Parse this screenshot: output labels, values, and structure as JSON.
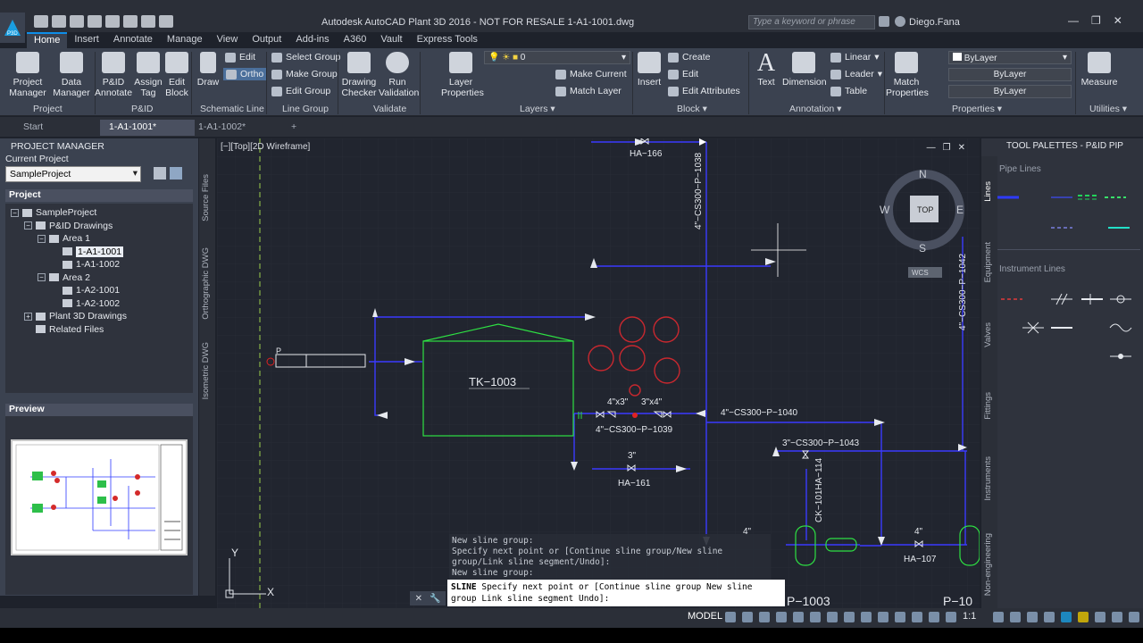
{
  "window": {
    "title": "Autodesk AutoCAD Plant 3D 2016 - NOT FOR RESALE   1-A1-1001.dwg",
    "search_placeholder": "Type a keyword or phrase",
    "user": "Diego.Fana",
    "app_badge": "P3D"
  },
  "tabs": [
    "Home",
    "Insert",
    "Annotate",
    "Manage",
    "View",
    "Output",
    "Add-ins",
    "A360",
    "Vault",
    "Express Tools"
  ],
  "ribbon": {
    "project_manager": "Project\nManager",
    "data_manager": "Data\nManager",
    "pid_annotate": "P&ID\nAnnotate",
    "assign_tag": "Assign\nTag",
    "edit_block": "Edit\nBlock",
    "draw": "Draw",
    "edit": "Edit",
    "ortho": "Ortho",
    "select_group": "Select Group",
    "make_group": "Make Group",
    "edit_group": "Edit Group",
    "drawing_checker": "Drawing\nChecker",
    "run_validation": "Run\nValidation",
    "layer_properties": "Layer\nProperties",
    "layer_value": "0",
    "make_current": "Make Current",
    "match_layer": "Match Layer",
    "insert": "Insert",
    "create": "Create",
    "block_edit": "Edit",
    "edit_attributes": "Edit Attributes",
    "text": "Text",
    "dimension": "Dimension",
    "linear": "Linear",
    "leader": "Leader",
    "table": "Table",
    "match_properties": "Match\nProperties",
    "bylayer1": "ByLayer",
    "bylayer2": "ByLayer",
    "bylayer3": "ByLayer",
    "measure": "Measure",
    "panels": {
      "project": "Project",
      "pid": "P&ID",
      "schematic_line": "Schematic Line",
      "line_group": "Line Group",
      "validate": "Validate",
      "layers": "Layers ▾",
      "block": "Block ▾",
      "annotation": "Annotation ▾",
      "properties": "Properties ▾",
      "utilities": "Utilities ▾"
    }
  },
  "file_tabs": [
    "Start",
    "1-A1-1001*",
    "1-A1-1002*",
    "+"
  ],
  "project_manager": {
    "title": "PROJECT MANAGER",
    "current_project_label": "Current Project",
    "current_project": "SampleProject",
    "project_section": "Project",
    "preview_section": "Preview",
    "tree": [
      {
        "label": "SampleProject",
        "indent": 0,
        "expander": "−"
      },
      {
        "label": "P&ID Drawings",
        "indent": 1,
        "expander": "−"
      },
      {
        "label": "Area 1",
        "indent": 2,
        "expander": "−"
      },
      {
        "label": "1-A1-1001",
        "indent": 3,
        "expander": "",
        "selected": true
      },
      {
        "label": "1-A1-1002",
        "indent": 3,
        "expander": ""
      },
      {
        "label": "Area 2",
        "indent": 2,
        "expander": "−"
      },
      {
        "label": "1-A2-1001",
        "indent": 3,
        "expander": ""
      },
      {
        "label": "1-A2-1002",
        "indent": 3,
        "expander": ""
      },
      {
        "label": "Plant 3D Drawings",
        "indent": 1,
        "expander": "+"
      },
      {
        "label": "Related Files",
        "indent": 1,
        "expander": ""
      }
    ],
    "side_tabs": [
      "Source Files",
      "Orthographic DWG",
      "Isometric DWG"
    ]
  },
  "viewport": {
    "label": "[−][Top][2D Wireframe]",
    "viewcube": {
      "n": "N",
      "s": "S",
      "e": "E",
      "w": "W",
      "top": "TOP",
      "wcs": "WCS"
    }
  },
  "drawing": {
    "tank": "TK−1003",
    "labels": [
      "HA−166",
      "4\"−CS300−P−1038",
      "4\"−CS300−P−1042",
      "4\"x3\"",
      "3\"x4\"",
      "4\"−CS300−P−1039",
      "4\"−CS300−P−1040",
      "3\"−CS300−P−1043",
      "3\"",
      "HA−161",
      "CK−101HA−114",
      "4\"",
      "4\"",
      "HA−107",
      "P−1003",
      "P−10",
      "P",
      "Y",
      "X"
    ]
  },
  "command": {
    "history": [
      "New sline group:",
      "Specify next point or [Continue sline group/New sline group/Link sline segment/Undo]:",
      "New sline group:"
    ],
    "prefix": "SLINE",
    "prompt": "Specify next point or [Continue sline group New sline group Link sline segment Undo]:"
  },
  "tool_palette": {
    "title": "TOOL PALETTES - P&ID PIP",
    "section1": "Pipe Lines",
    "section2": "Instrument Lines",
    "vtabs": [
      "Lines",
      "Equipment",
      "Valves",
      "Fittings",
      "Instruments",
      "Non-engineering"
    ],
    "pipe_colors": [
      "#2e3bff",
      "#3b47d6",
      "#22d35a",
      "#39e06a",
      "#7a7fe0",
      "#22e0c8"
    ],
    "instr_colors": [
      "#e03b3b",
      "#e6e9ee",
      "#e6e9ee",
      "#e6e9ee"
    ]
  },
  "status": {
    "model": "MODEL",
    "scale": "1:1"
  }
}
